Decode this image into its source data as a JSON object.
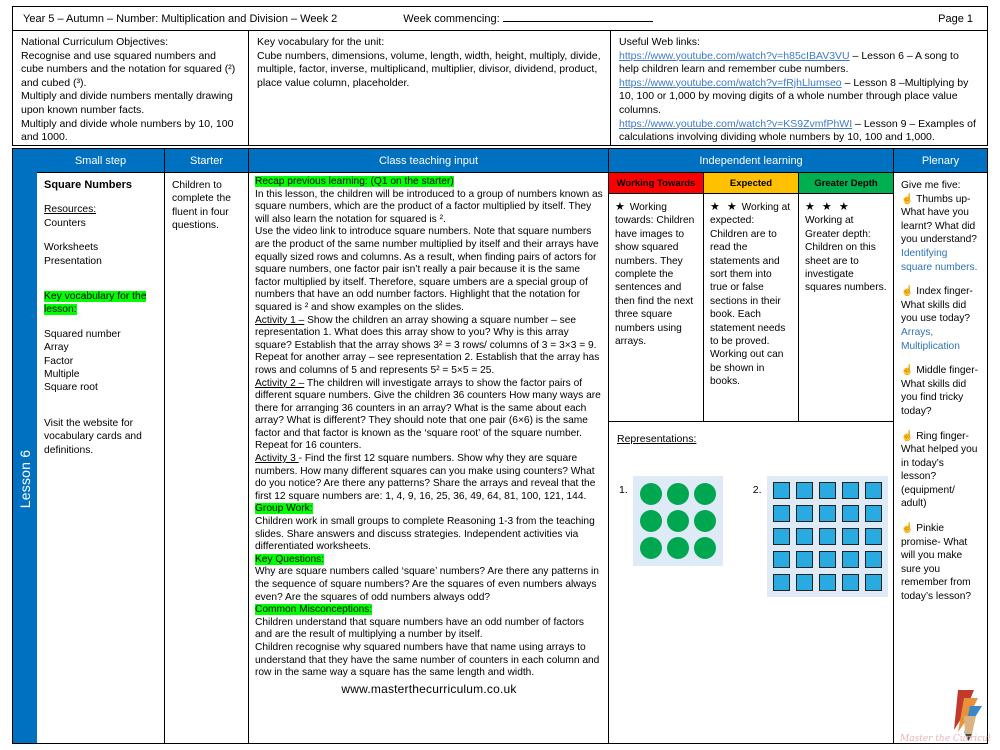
{
  "header": {
    "title": "Year 5 – Autumn – Number: Multiplication and Division – Week 2",
    "week_commencing_label": "Week commencing:",
    "page_number": "Page 1"
  },
  "info": {
    "objectives": {
      "heading": "National Curriculum Objectives:",
      "lines": [
        "Recognise and use squared numbers  and cube numbers and the notation for squared (²) and cubed (³).",
        "Multiply and divide numbers mentally drawing upon known number facts.",
        "Multiply and divide whole numbers by 10, 100 and 1000."
      ]
    },
    "vocabulary": {
      "heading": "Key vocabulary for the unit:",
      "text": "Cube numbers, dimensions, volume, length, width, height, multiply, divide, multiple, factor, inverse, multiplicand, multiplier, divisor, dividend, product, place value column, placeholder."
    },
    "weblinks": {
      "heading": "Useful Web links:",
      "items": [
        {
          "url": "https://www.youtube.com/watch?v=h85cIBAV3VU",
          "desc": " – Lesson 6 – A song to help children learn and remember cube numbers."
        },
        {
          "url": "https://www.youtube.com/watch?v=fRjhLlumseo",
          "desc": " – Lesson 8 –Multiplying by 10, 100 or 1,000 by moving digits of a whole number through place value columns."
        },
        {
          "url": "https://www.youtube.com/watch?v=KS9ZvmfPhWI",
          "desc": " – Lesson 9 – Examples of calculations involving dividing whole numbers by 10, 100 and 1,000."
        }
      ]
    }
  },
  "spine": {
    "lesson_label": "Lesson 6"
  },
  "columns": {
    "small_step": "Small step",
    "starter": "Starter",
    "class_teaching_input": "Class teaching input",
    "independent_learning": "Independent learning",
    "plenary": "Plenary"
  },
  "small_step": {
    "title": "Square Numbers",
    "resources_heading": "Resources:",
    "resources": [
      "Counters"
    ],
    "resources2": [
      "Worksheets",
      "Presentation"
    ],
    "key_vocab_heading": "Key vocabulary for the lesson:",
    "key_vocab": [
      "Squared number",
      "Array",
      "Factor",
      "Multiple",
      "Square root"
    ],
    "footer": "Visit the website for vocabulary cards and definitions."
  },
  "starter": {
    "text": "Children to complete the fluent in four questions."
  },
  "teaching": {
    "recap_heading": "Recap previous learning: (Q1 on the starter)",
    "intro": "In this lesson, the children will be introduced to a group of numbers known as square numbers, which are the product of a factor multiplied by itself. They will also learn the notation for squared is ².",
    "body": "Use the video link to introduce square numbers. Note that square numbers are the product of the same number multiplied by itself and their arrays have equally sized rows and columns. As a result, when finding pairs of actors for square numbers, one factor pair isn’t really a pair because it is the same factor multiplied by itself. Therefore, square umbers  are a special group of numbers that have an odd number factors. Highlight that the notation for squared is ² and show examples on the slides.",
    "activity1_label": "Activity 1 –",
    "activity1": " Show the children an array showing a square number – see representation 1. What does this array show to you? Why is this array square? Establish that the array shows 3² = 3 rows/ columns of 3 = 3×3 = 9. Repeat for another array – see representation 2. Establish that the array has rows and columns of 5 and represents 5² = 5×5 = 25.",
    "activity2_label": "Activity 2 –",
    "activity2": " The children will investigate arrays to show the factor pairs of different square numbers. Give the children 36 counters How many ways are there for arranging 36 counters in an array? What is the same about each array? What is different? They should note that one pair (6×6) is the same factor and that factor is known as the ‘square root’ of the square number. Repeat for 16 counters.",
    "activity3_label": "Activity 3 ",
    "activity3": "- Find the first 12 square numbers. Show why they are square numbers. How many different squares can you make using counters? What do you notice? Are there any patterns? Share the arrays and reveal that the first 12 square numbers are: 1, 4, 9, 16, 25, 36, 49, 64, 81, 100, 121, 144.",
    "group_work_heading": "Group Work:",
    "group_work": "Children work in small groups to complete Reasoning 1-3 from the teaching slides. Share answers and discuss strategies. Independent activities via differentiated worksheets.",
    "key_questions_heading": "Key Questions:",
    "key_questions": "Why are square numbers called ‘square’ numbers? Are there any patterns in the sequence of square numbers? Are the squares of even numbers always even? Are the squares of odd numbers always odd?",
    "misconceptions_heading": "Common Misconceptions:",
    "misconceptions1": "Children understand that square numbers have an odd number of factors and are the result of multiplying a number by itself.",
    "misconceptions2": "Children recognise why squared numbers have that name using arrays to understand that they have the same number of counters in each column and row in the same way a square has the same length and width.",
    "website": "www.masterthecurriculum.co.uk"
  },
  "independent": {
    "bands": [
      {
        "label": "Working Towards",
        "color": "#FF0000",
        "text_color": "#000000",
        "stars": "★",
        "text": " Working towards: Children have images to show squared numbers. They complete the sentences and then find the next three square numbers using arrays."
      },
      {
        "label": "Expected",
        "color": "#FFC000",
        "text_color": "#000000",
        "stars": "★ ★",
        "text": " Working at expected: Children are to read the statements and sort them into true or false sections in their book. Each statement needs to be proved. Working out can be shown in books."
      },
      {
        "label": "Greater Depth",
        "color": "#00B050",
        "text_color": "#000000",
        "stars": "★ ★ ★",
        "text": "Working at Greater depth: Children on this sheet are to investigate squares numbers."
      }
    ],
    "representations_label": "Representations:",
    "rep1": {
      "number": "1.",
      "rows": 3,
      "cols": 3,
      "shape": "circle",
      "color": "#00A650",
      "bg": "#DEEAF6"
    },
    "rep2": {
      "number": "2.",
      "rows": 5,
      "cols": 5,
      "shape": "square",
      "color": "#29ABE2",
      "bg": "#DEEAF6"
    }
  },
  "plenary": {
    "heading": "Give me five:",
    "items": [
      {
        "icon": "hand-icon",
        "text": " Thumbs up- What have you learnt? What did you understand? ",
        "answer": "Identifying square numbers."
      },
      {
        "icon": "hand-icon",
        "text": " Index finger- What skills did you use today? ",
        "answer": "Arrays, Multiplication"
      },
      {
        "icon": "hand-icon",
        "text": " Middle finger- What skills did you find tricky today?",
        "answer": ""
      },
      {
        "icon": "hand-icon",
        "text": " Ring finger- What helped you in today’s lesson? (equipment/ adult)",
        "answer": ""
      },
      {
        "icon": "hand-icon",
        "text": " Pinkie promise- What will you make sure you remember from today’s lesson?",
        "answer": ""
      }
    ]
  },
  "logo": {
    "name": "master-the-curriculum-logo",
    "caption": "Master the Curriculum"
  }
}
